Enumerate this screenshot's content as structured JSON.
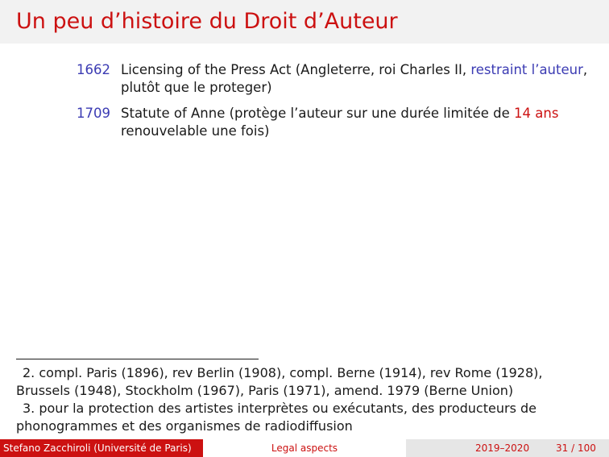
{
  "title": "Un peu d’histoire du Droit d’Auteur",
  "entries": [
    {
      "year": "1662",
      "text_before": "Licensing of the Press Act (Angleterre, roi Charles II, ",
      "highlight": "restraint l’auteur",
      "text_after": ", plutôt que le proteger)"
    },
    {
      "year": "1709",
      "text_before": "Statute of Anne (protège l’auteur sur une durée limitée de ",
      "highlight": "14 ans",
      "text_after": " renouvelable une fois)"
    }
  ],
  "footnotes": [
    {
      "num": "2.",
      "text": " compl. Paris (1896), rev Berlin (1908), compl. Berne (1914), rev Rome (1928), Brussels (1948), Stockholm (1967), Paris (1971), amend. 1979 (Berne Union)"
    },
    {
      "num": "3.",
      "text": " pour la protection des artistes interprètes ou exécutants, des producteurs de phonogrammes et des organismes de radiodiffusion"
    }
  ],
  "footer": {
    "author": "Stefano Zacchiroli (Université de Paris)",
    "topic": "Legal aspects",
    "year": "2019–2020",
    "page": "31 / 100"
  },
  "colors": {
    "accent": "#cc1111",
    "link": "#3b3bb3",
    "title_bg": "#f2f2f2",
    "footer_right_bg": "#e6e6e6"
  }
}
